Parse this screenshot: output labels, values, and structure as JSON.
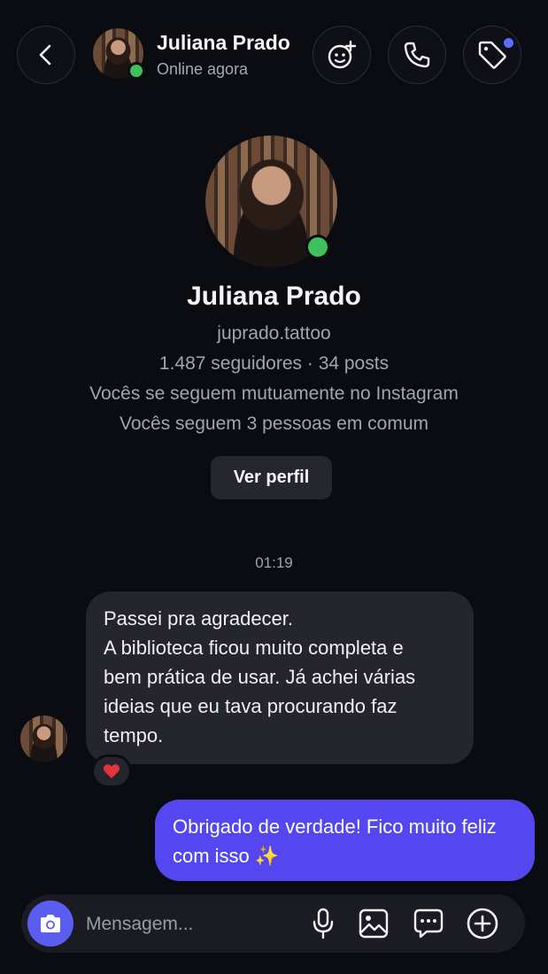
{
  "header": {
    "name": "Juliana Prado",
    "status": "Online agora",
    "back_icon": "chevron-left-icon",
    "actions": [
      "sticker-add-icon",
      "phone-icon",
      "tag-icon"
    ],
    "accent_dot_color": "#5b6cff"
  },
  "profile": {
    "name": "Juliana Prado",
    "username": "juprado.tattoo",
    "stats": "1.487 seguidores · 34 posts",
    "mutual_follow": "Vocês se seguem mutuamente no Instagram",
    "common_follow": "Vocês seguem 3 pessoas em comum",
    "view_profile_label": "Ver perfil"
  },
  "conversation": {
    "timestamp": "01:19",
    "incoming": {
      "lines": [
        "Passei pra agradecer.",
        "A biblioteca ficou muito completa e",
        "bem prática de usar. Já achei várias",
        "ideias que eu tava procurando faz",
        "tempo."
      ],
      "reaction": "❤️"
    },
    "outgoing": {
      "lines": [
        "Obrigado de verdade! Fico muito feliz",
        "com isso ✨"
      ]
    }
  },
  "composer": {
    "placeholder": "Mensagem...",
    "icons": [
      "camera-icon",
      "microphone-icon",
      "gallery-icon",
      "chat-bubble-icon",
      "plus-circle-icon"
    ],
    "camera_color": "#5b5cf0"
  },
  "colors": {
    "background": "#0b0c12",
    "incoming_bubble": "#24252d",
    "outgoing_bubble": "#5547f0",
    "online": "#3ec15a"
  }
}
